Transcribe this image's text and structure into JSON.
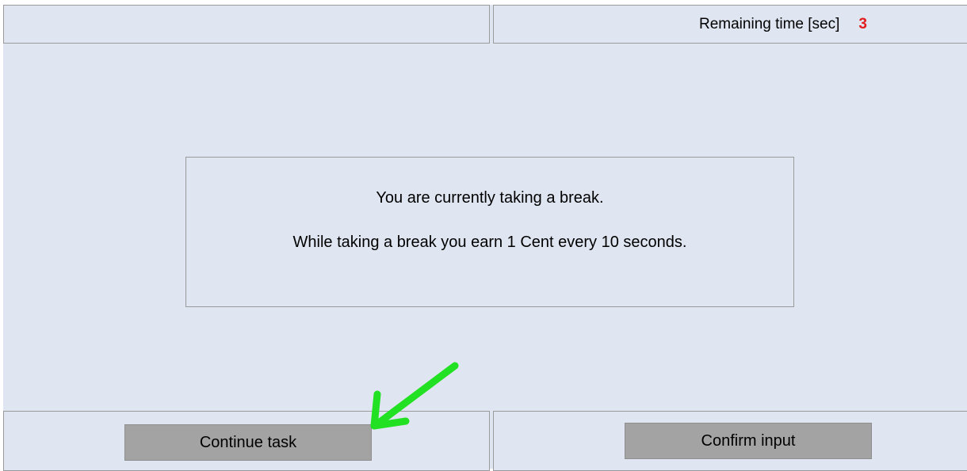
{
  "header": {
    "timer_label": "Remaining time [sec]",
    "timer_value": "3"
  },
  "message": {
    "line1": "You are currently taking a break.",
    "line2": "While taking a break you earn 1 Cent every 10 seconds."
  },
  "buttons": {
    "continue_label": "Continue task",
    "confirm_label": "Confirm input"
  },
  "colors": {
    "background": "#dfe6f2",
    "border": "#9a9a9a",
    "button": "#a3a3a3",
    "timer_value": "#e11d1d",
    "annotation_arrow": "#22e022"
  },
  "annotations": {
    "arrow_icon": "green-arrow-icon"
  }
}
